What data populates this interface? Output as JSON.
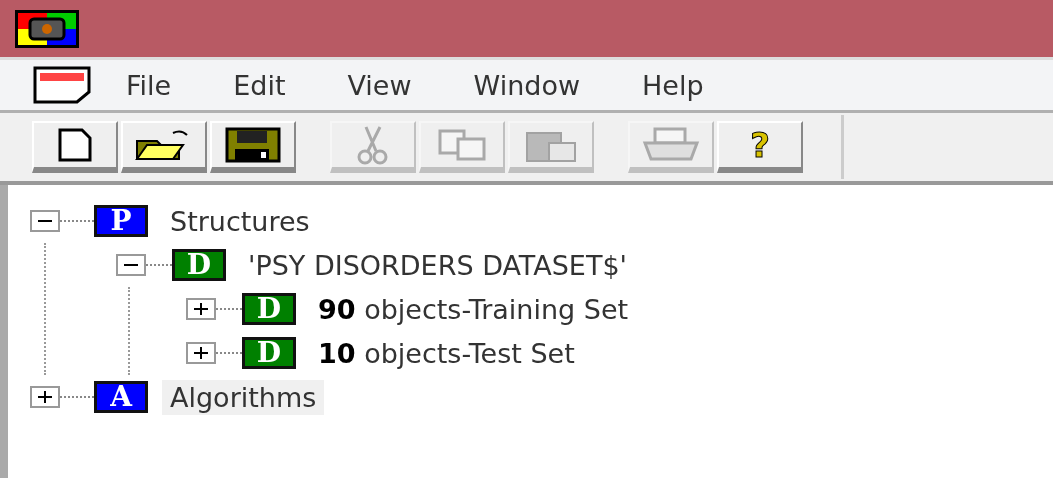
{
  "menu": [
    {
      "label": "File"
    },
    {
      "label": "Edit"
    },
    {
      "label": "View"
    },
    {
      "label": "Window"
    },
    {
      "label": "Help"
    }
  ],
  "toolbar": [
    [
      {
        "kind": "new",
        "disabled": false
      },
      {
        "kind": "open",
        "disabled": false
      },
      {
        "kind": "save",
        "disabled": false
      }
    ],
    [
      {
        "kind": "cut",
        "disabled": true
      },
      {
        "kind": "copy",
        "disabled": true
      },
      {
        "kind": "paste",
        "disabled": true
      }
    ],
    [
      {
        "kind": "print",
        "disabled": true
      },
      {
        "kind": "help",
        "glyph": "?",
        "disabled": false
      }
    ]
  ],
  "tree": [
    {
      "letter": "P",
      "color": "#0000ff",
      "label": "Structures",
      "expanded": true,
      "selected": false,
      "children": [
        {
          "letter": "D",
          "color": "#008000",
          "label": "'PSY DISORDERS DATASET$'",
          "expanded": true,
          "selected": false,
          "children": [
            {
              "letter": "D",
              "color": "#008000",
              "label": "**90** objects-Training Set",
              "expanded": false,
              "selected": false
            },
            {
              "letter": "D",
              "color": "#008000",
              "label": "**10** objects-Test Set",
              "expanded": false,
              "selected": false
            }
          ]
        }
      ]
    },
    {
      "letter": "A",
      "color": "#0000ff",
      "label": "Algorithms",
      "expanded": false,
      "selected": true
    }
  ]
}
